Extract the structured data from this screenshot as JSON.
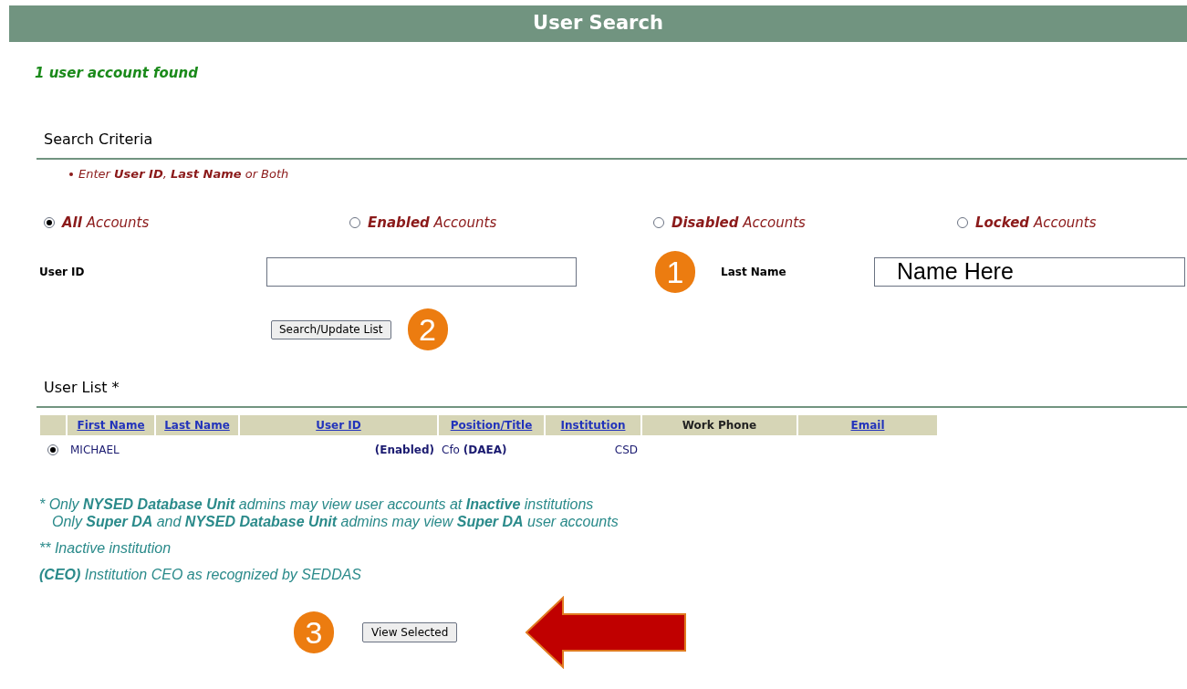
{
  "header": {
    "title": "User Search"
  },
  "result_message": "1 user account found",
  "search_criteria": {
    "heading": "Search Criteria",
    "hint": "Enter **User ID**, **Last Name** or Both",
    "account_filters": [
      {
        "label": "**All** Accounts",
        "selected": true
      },
      {
        "label": "**Enabled** Accounts",
        "selected": false
      },
      {
        "label": "**Disabled** Accounts",
        "selected": false
      },
      {
        "label": "**Locked** Accounts",
        "selected": false
      }
    ],
    "user_id": {
      "label": "User ID"
    },
    "last_name": {
      "label": "Last Name",
      "value": "Name Here"
    },
    "search_button": "Search/Update List"
  },
  "callouts": [
    "1",
    "2",
    "3"
  ],
  "user_list": {
    "heading": "User List *",
    "columns": [
      {
        "label": "First Name",
        "sortable": true
      },
      {
        "label": "Last Name",
        "sortable": true
      },
      {
        "label": "User ID",
        "sortable": true
      },
      {
        "label": "Position/Title",
        "sortable": true
      },
      {
        "label": "Institution",
        "sortable": true
      },
      {
        "label": "Work Phone",
        "sortable": false
      },
      {
        "label": "Email",
        "sortable": true
      }
    ],
    "rows": [
      {
        "selected": true,
        "cells": [
          "MICHAEL",
          "",
          "**(Enabled)**",
          "Cfo **(DAEA)**",
          "CSD",
          "",
          ""
        ]
      }
    ]
  },
  "footnotes": [
    "* Only **NYSED Database Unit** admins may view user accounts at **Inactive** institutions",
    "Only **Super DA** and **NYSED Database Unit** admins may view **Super DA** user accounts",
    "** Inactive institution",
    "**(CEO)** Institution CEO as recognized by SEDDAS"
  ],
  "view_button": "View Selected"
}
